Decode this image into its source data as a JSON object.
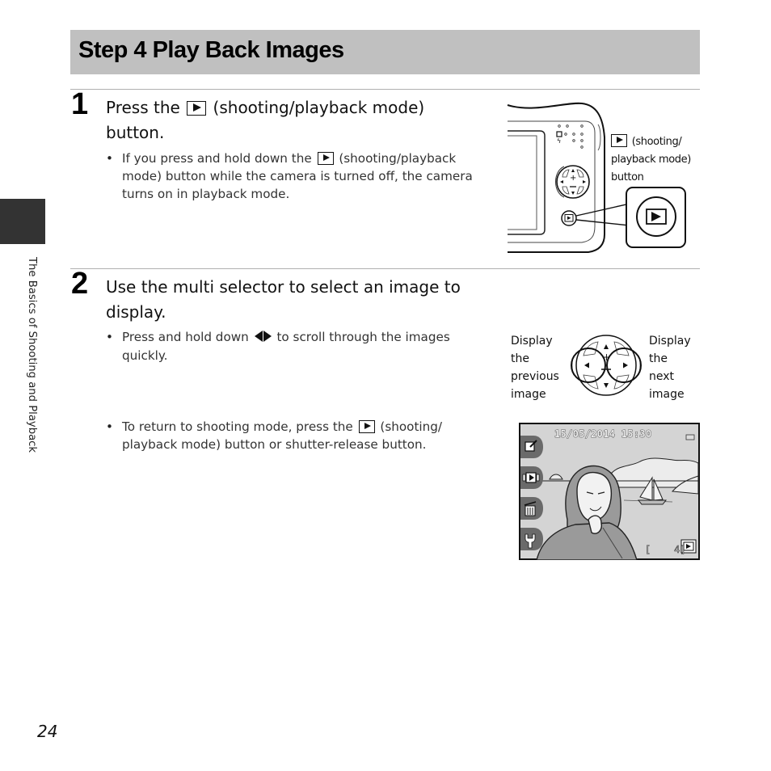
{
  "page": {
    "title": "Step 4 Play Back Images",
    "side_label": "The Basics of Shooting and Playback",
    "page_number": "24"
  },
  "steps": [
    {
      "number": "1",
      "heading_before": "Press the",
      "heading_icon": "playback-button-icon",
      "heading_after": "(shooting/playback mode) button.",
      "bullets": [
        {
          "before": "If you press and hold down the",
          "icon": "playback-button-icon",
          "after": "(shooting/playback mode) button while the camera is turned off, the camera turns on in playback mode."
        }
      ],
      "figure": {
        "callout_icon": "playback-button-icon",
        "callout_line1": "(shooting/",
        "callout_line2": "playback mode)",
        "callout_line3": "button"
      }
    },
    {
      "number": "2",
      "heading": "Use the multi selector to select an image to display.",
      "bullets": [
        {
          "before": "Press and hold down",
          "icon": "left-right-arrows-icon",
          "after": "to scroll through the images quickly."
        },
        {
          "before": "To return to shooting mode, press the",
          "icon": "playback-button-icon",
          "after": "(shooting/ playback mode) button or shutter-release button."
        }
      ],
      "figure": {
        "left_label": [
          "Display",
          "the",
          "previous",
          "image"
        ],
        "right_label": [
          "Display",
          "the",
          "next",
          "image"
        ]
      },
      "screen": {
        "datetime": "15/05/2014 15:30",
        "counter": "[    4]",
        "side_icons": [
          "edit-icon",
          "slideshow-icon",
          "delete-icon",
          "wrench-setup-icon"
        ],
        "mode_icon": "playback-mode-icon",
        "battery_icon": "battery-icon"
      }
    }
  ],
  "colors": {
    "title_bar": "#c0c0c0",
    "side_tab": "#333333",
    "rule": "#b0b0b0"
  }
}
